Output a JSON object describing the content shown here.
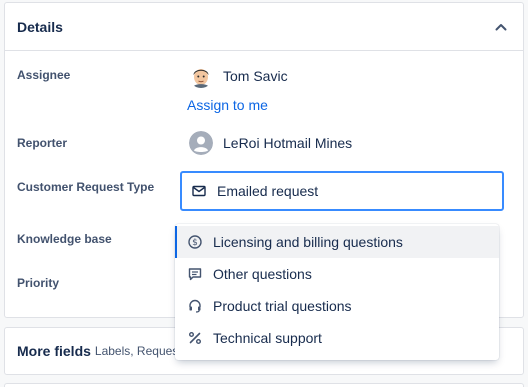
{
  "details": {
    "title": "Details",
    "fields": {
      "assignee_label": "Assignee",
      "reporter_label": "Reporter",
      "crt_label": "Customer Request Type",
      "kb_label": "Knowledge base",
      "priority_label": "Priority"
    },
    "assignee": {
      "name": "Tom Savic",
      "assign_link": "Assign to me"
    },
    "reporter": {
      "name": "LeRoi Hotmail Mines"
    },
    "request_type": {
      "value": "Emailed request"
    }
  },
  "dropdown": {
    "options": [
      {
        "label": "Licensing and billing questions",
        "icon": "dollar-circle-icon"
      },
      {
        "label": "Other questions",
        "icon": "comment-icon"
      },
      {
        "label": "Product trial questions",
        "icon": "headset-icon"
      },
      {
        "label": "Technical support",
        "icon": "tools-icon"
      }
    ]
  },
  "more_fields": {
    "title": "More fields",
    "subtitle": "Labels, Reques"
  },
  "colors": {
    "accent": "#0c66e4",
    "focus_border": "#388bff"
  }
}
